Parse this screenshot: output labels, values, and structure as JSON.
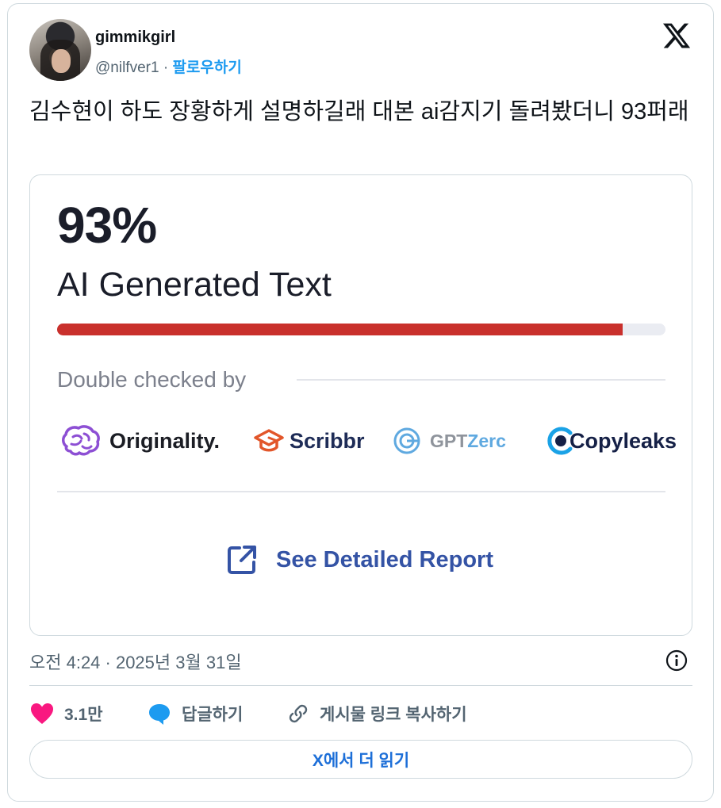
{
  "author": {
    "name": "gimmikgirl",
    "handle": "@nilfver1",
    "separator": " · ",
    "follow_label": "팔로우하기"
  },
  "tweet": {
    "text": "김수현이 하도 장황하게 설명하길래 대본 ai감지기 돌려봤더니 93퍼래"
  },
  "embed": {
    "percent": "93%",
    "label": "AI Generated Text",
    "ai_fraction": 0.93,
    "double_checked_label": "Double checked by",
    "checkers": {
      "originality": "Originality.",
      "scribbr": "Scribbr",
      "gptzero_prefix": "GPT",
      "gptzero_suffix": "Zerc",
      "copyleaks": "Copyleaks"
    },
    "report_label": "See Detailed Report"
  },
  "meta": {
    "timestamp": "오전 4:24 · 2025년 3월 31일"
  },
  "actions": {
    "likes": "3.1만",
    "reply": "답글하기",
    "copy_link": "게시물 링크 복사하기"
  },
  "read_more": "X에서 더 읽기",
  "colors": {
    "bar_fill": "#c9302c",
    "follow": "#1d9bf0",
    "report": "#3453a5",
    "heart": "#f91880",
    "reply_bubble": "#1d9bf0"
  }
}
